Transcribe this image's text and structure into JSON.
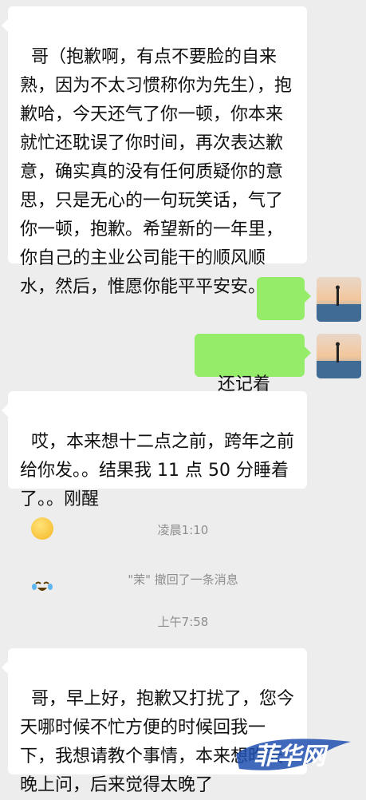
{
  "messages": {
    "m1": "哥（抱歉啊，有点不要脸的自来熟，因为不太习惯称你为先生），抱歉哈，今天还气了你一顿，你本来就忙还耽误了你时间，再次表达歉意，确实真的没有任何质疑你的意思，只是无心的一句玩笑话，气了你一顿，抱歉。希望新的一年里，你自己的主业公司能干的顺风顺水，然后，惟愿你能平平安安。",
    "m3": "还记着呢？",
    "m4": "哎，本来想十二点之前，跨年之前给你发。。结果我 11 点 50 分睡着了。。刚醒",
    "m5": "哥，早上好，抱歉又打扰了，您今天哪时候不忙方便的时候回我一下，我想请教个事情，本来想昨天晚上问，后来觉得太晚了"
  },
  "system": {
    "time1": "凌晨1:10",
    "recall": "\"茉\" 撤回了一条消息",
    "time2": "上午7:58"
  },
  "watermark": "菲华网",
  "colors": {
    "background": "#ededed",
    "bubble_left": "#ffffff",
    "bubble_right": "#95ec69",
    "system_text": "#8e8e8e",
    "watermark": "#1f4fb0"
  },
  "icons": {
    "emoji_self": "grin-emoji-icon",
    "emoji_laugh_cry": "laugh-cry-emoji-icon",
    "avatar": "beach-silhouette-avatar"
  }
}
